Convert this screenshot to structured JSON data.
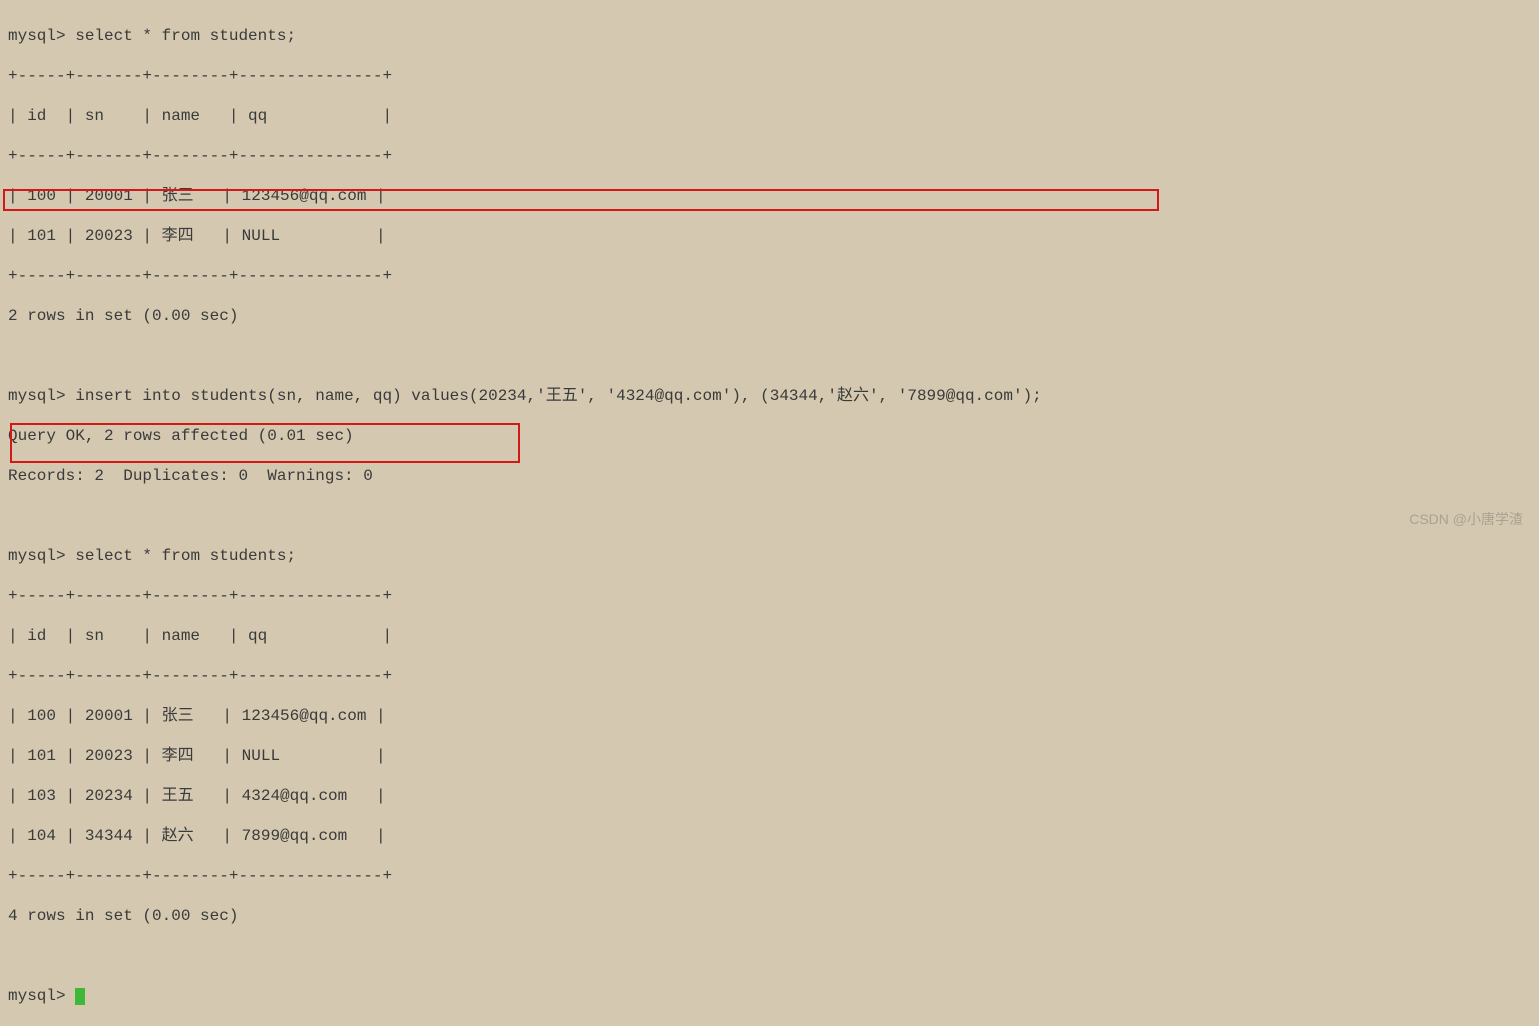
{
  "prompt": "mysql>",
  "query1": "select * from students;",
  "table1": {
    "sep": "+-----+-------+--------+---------------+",
    "head": "| id  | sn    | name   | qq            |",
    "row1": "| 100 | 20001 | 张三   | 123456@qq.com |",
    "row2": "| 101 | 20023 | 李四   | NULL          |"
  },
  "result1": "2 rows in set (0.00 sec)",
  "query2": "insert into students(sn, name, qq) values(20234,'王五', '4324@qq.com'), (34344,'赵六', '7899@qq.com');",
  "result2a": "Query OK, 2 rows affected (0.01 sec)",
  "result2b": "Records: 2  Duplicates: 0  Warnings: 0",
  "query3": "select * from students;",
  "table2": {
    "sep": "+-----+-------+--------+---------------+",
    "head": "| id  | sn    | name   | qq            |",
    "row1": "| 100 | 20001 | 张三   | 123456@qq.com |",
    "row2": "| 101 | 20023 | 李四   | NULL          |",
    "row3": "| 103 | 20234 | 王五   | 4324@qq.com   |",
    "row4": "| 104 | 34344 | 赵六   | 7899@qq.com   |"
  },
  "result3": "4 rows in set (0.00 sec)",
  "watermark": "CSDN @小唐学渣"
}
